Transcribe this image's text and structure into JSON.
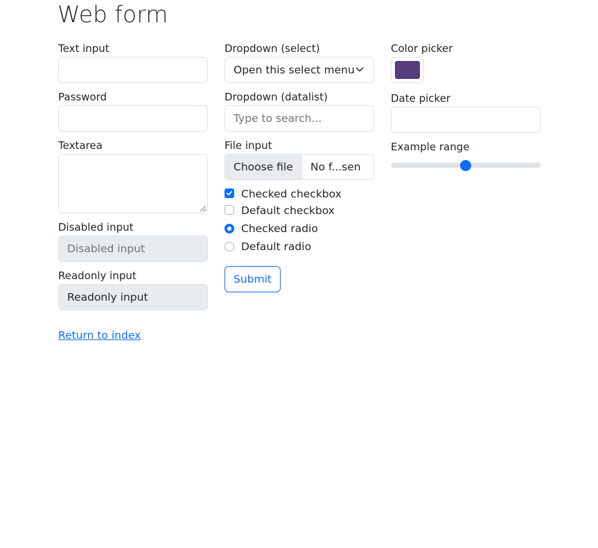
{
  "title": "Web form",
  "col1": {
    "text_input_label": "Text input",
    "text_input_value": "",
    "password_label": "Password",
    "password_value": "",
    "textarea_label": "Textarea",
    "textarea_value": "",
    "disabled_label": "Disabled input",
    "disabled_placeholder": "Disabled input",
    "readonly_label": "Readonly input",
    "readonly_value": "Readonly input"
  },
  "col2": {
    "select_label": "Dropdown (select)",
    "select_value": "Open this select menu",
    "datalist_label": "Dropdown (datalist)",
    "datalist_placeholder": "Type to search...",
    "file_label": "File input",
    "file_button": "Choose file",
    "file_name": "No f...sen",
    "checked_checkbox": "Checked checkbox",
    "default_checkbox": "Default checkbox",
    "checked_radio": "Checked radio",
    "default_radio": "Default radio",
    "submit": "Submit"
  },
  "col3": {
    "color_label": "Color picker",
    "color_value": "#563d7c",
    "date_label": "Date picker",
    "date_value": "",
    "range_label": "Example range",
    "range_value": 5,
    "range_min": 0,
    "range_max": 10
  },
  "return_link": "Return to index",
  "colors": {
    "accent": "#0d6efd",
    "border": "#dee2e6",
    "disabled_bg": "#e9ecef",
    "text": "#212529",
    "muted": "#6c757d"
  }
}
